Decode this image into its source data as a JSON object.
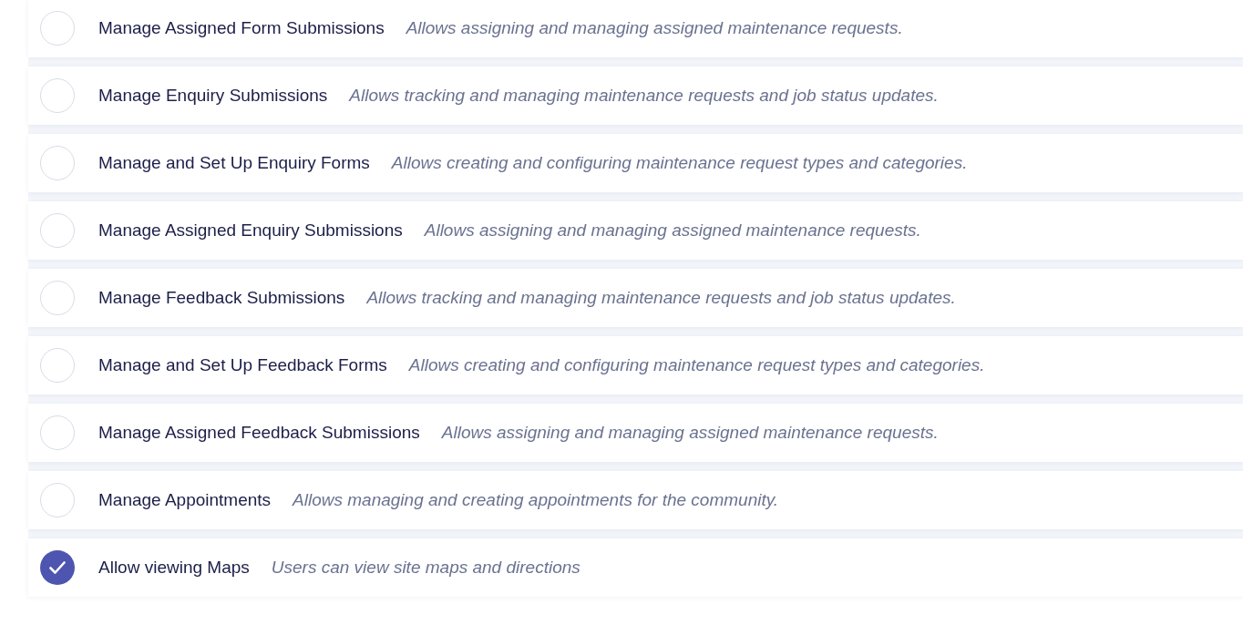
{
  "permissions": [
    {
      "title": "Manage Assigned Form Submissions",
      "description": "Allows assigning and managing assigned maintenance requests.",
      "checked": false
    },
    {
      "title": "Manage Enquiry Submissions",
      "description": "Allows tracking and managing maintenance requests and job status updates.",
      "checked": false
    },
    {
      "title": "Manage and Set Up Enquiry Forms",
      "description": "Allows creating and configuring maintenance request types and categories.",
      "checked": false
    },
    {
      "title": "Manage Assigned Enquiry Submissions",
      "description": "Allows assigning and managing assigned maintenance requests.",
      "checked": false
    },
    {
      "title": "Manage Feedback Submissions",
      "description": "Allows tracking and managing maintenance requests and job status updates.",
      "checked": false
    },
    {
      "title": "Manage and Set Up Feedback Forms",
      "description": "Allows creating and configuring maintenance request types and categories.",
      "checked": false
    },
    {
      "title": "Manage Assigned Feedback Submissions",
      "description": "Allows assigning and managing assigned maintenance requests.",
      "checked": false
    },
    {
      "title": "Manage Appointments",
      "description": "Allows managing and creating appointments for the community.",
      "checked": false
    },
    {
      "title": "Allow viewing Maps",
      "description": "Users can view site maps and directions",
      "checked": true
    }
  ]
}
